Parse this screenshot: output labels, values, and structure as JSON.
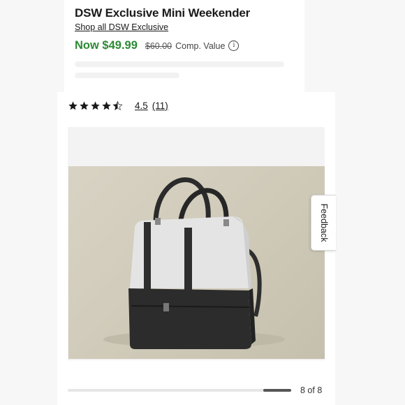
{
  "product": {
    "title": "DSW Exclusive Mini Weekender",
    "shop_link": "Shop all DSW Exclusive",
    "price_now": "Now $49.99",
    "price_was": "$60.00",
    "price_comp": "Comp. Value"
  },
  "rating": {
    "stars": 4.5,
    "value": "4.5",
    "count": "(11)"
  },
  "gallery": {
    "counter": "8 of 8",
    "current": 8,
    "total": 8
  },
  "feedback": {
    "label": "Feedback"
  },
  "colors": {
    "price_green": "#2d8a34",
    "star": "#1a1a1a"
  },
  "icons": {
    "info": "info-icon",
    "star": "star-icon"
  }
}
